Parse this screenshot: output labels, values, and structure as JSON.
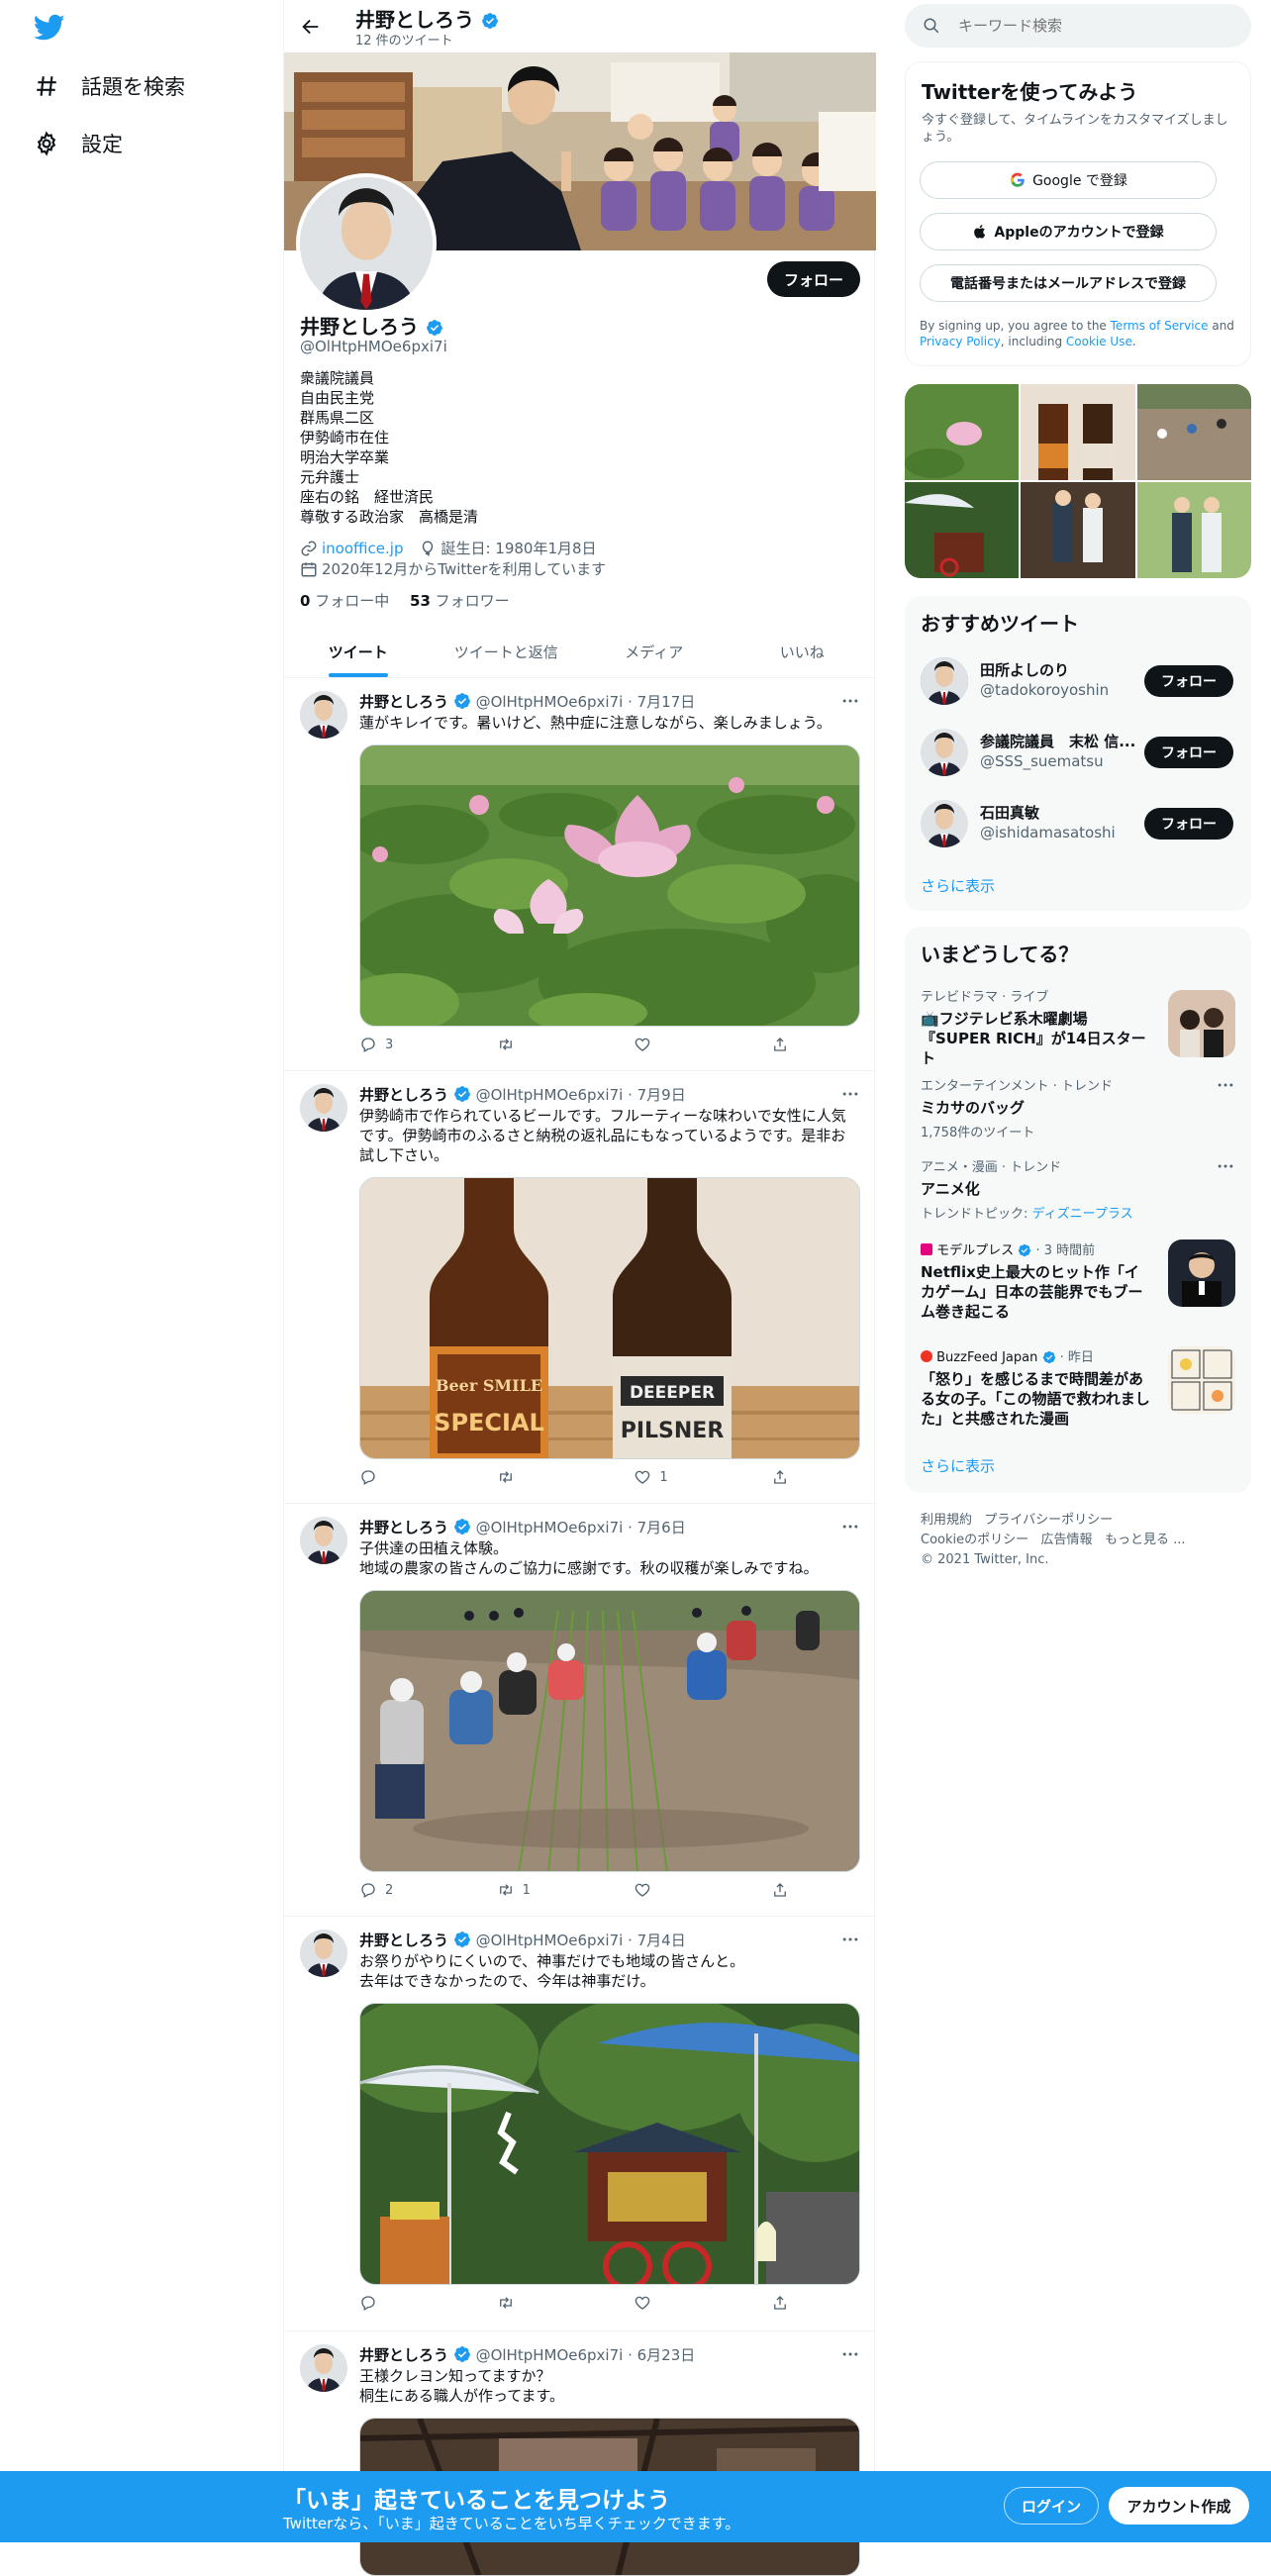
{
  "colors": {
    "accent": "#1d9bf0",
    "text": "#0f1419",
    "muted": "#536471",
    "banner": "#1d9bf0"
  },
  "nav": {
    "explore_label": "話題を検索",
    "settings_label": "設定"
  },
  "header": {
    "name": "井野としろう",
    "tweet_count": "12 件のツイート"
  },
  "profile": {
    "name": "井野としろう",
    "handle": "@OlHtpHMOe6pxi7i",
    "follow_label": "フォロー",
    "bio": [
      "衆議院議員",
      "自由民主党",
      "群馬県二区",
      "伊勢崎市在住",
      "明治大学卒業",
      "元弁護士",
      "座右の銘　経世済民",
      "尊敬する政治家　高橋是清"
    ],
    "website": "inooffice.jp",
    "birthday": "誕生日: 1980年1月8日",
    "joined": "2020年12月からTwitterを利用しています",
    "following_count": "0",
    "following_label": "フォロー中",
    "followers_count": "53",
    "followers_label": "フォロワー"
  },
  "tabs": [
    "ツイート",
    "ツイートと返信",
    "メディア",
    "いいね"
  ],
  "tweets": [
    {
      "name": "井野としろう",
      "handle": "@OlHtpHMOe6pxi7i",
      "date": "· 7月17日",
      "text": "蓮がキレイです。暑いけど、熱中症に注意しながら、楽しみましょう。",
      "reply": "3",
      "retweet": "",
      "like": ""
    },
    {
      "name": "井野としろう",
      "handle": "@OlHtpHMOe6pxi7i",
      "date": "· 7月9日",
      "text": "伊勢崎市で作られているビールです。フルーティーな味わいで女性に人気です。伊勢崎市のふるさと納税の返礼品にもなっているようです。是非お試し下さい。",
      "reply": "",
      "retweet": "",
      "like": "1",
      "beer1": "Beer SMILE",
      "beer1b": "SPECIAL",
      "beer2": "DEEEPER",
      "beer2b": "PILSNER"
    },
    {
      "name": "井野としろう",
      "handle": "@OlHtpHMOe6pxi7i",
      "date": "· 7月6日",
      "text": "子供達の田植え体験。\n地域の農家の皆さんのご協力に感謝です。秋の収穫が楽しみですね。",
      "reply": "2",
      "retweet": "1",
      "like": ""
    },
    {
      "name": "井野としろう",
      "handle": "@OlHtpHMOe6pxi7i",
      "date": "· 7月4日",
      "text": "お祭りがやりにくいので、神事だけでも地域の皆さんと。\n去年はできなかったので、今年は神事だけ。",
      "reply": "",
      "retweet": "",
      "like": ""
    },
    {
      "name": "井野としろう",
      "handle": "@OlHtpHMOe6pxi7i",
      "date": "· 6月23日",
      "text": "王様クレヨン知ってますか？\n桐生にある職人が作ってます。"
    }
  ],
  "search": {
    "placeholder": "キーワード検索"
  },
  "signup": {
    "title": "Twitterを使ってみよう",
    "subtitle": "今すぐ登録して、タイムラインをカスタマイズしましょう。",
    "google_label": "Google で登録",
    "apple_label": "Appleのアカウントで登録",
    "phone_label": "電話番号またはメールアドレスで登録",
    "legal_prefix": "By signing up, you agree to the ",
    "terms": "Terms of Service",
    "and": " and ",
    "privacy": "Privacy Policy",
    "including": ", including ",
    "cookie": "Cookie Use",
    "period": "."
  },
  "who": {
    "title": "おすすめツイート",
    "users": [
      {
        "name": "田所よしのり",
        "handle": "@tadokoroyoshin",
        "follow": "フォロー"
      },
      {
        "name": "参議院議員　末松 信...",
        "handle": "@SSS_suematsu",
        "follow": "フォロー"
      },
      {
        "name": "石田真敏",
        "handle": "@ishidamasatoshi",
        "follow": "フォロー"
      }
    ],
    "more": "さらに表示"
  },
  "trends": {
    "title": "いまどうしてる？",
    "items": [
      {
        "meta": "テレビドラマ · ライブ",
        "title": "📺フジテレビ系木曜劇場『SUPER RICH』が14日スタート"
      },
      {
        "meta": "エンターテインメント · トレンド",
        "title": "ミカサのバッグ",
        "sub": "1,758件のツイート"
      },
      {
        "meta": "アニメ・漫画 · トレンド",
        "title": "アニメ化",
        "sub_prefix": "トレンドトピック: ",
        "sub_link": "ディズニープラス"
      },
      {
        "source": "モデルプレス",
        "time": "· 3 時間前",
        "title": "Netflix史上最大のヒット作「イカゲーム」日本の芸能界でもブーム巻き起こる"
      },
      {
        "source": "BuzzFeed Japan",
        "time": "· 昨日",
        "title": "「怒り」を感じるまで時間差がある女の子。「この物語で救われました」と共感された漫画"
      }
    ],
    "more": "さらに表示"
  },
  "footer": {
    "links": [
      "利用規約",
      "プライバシーポリシー",
      "Cookieのポリシー",
      "広告情報",
      "もっと見る ..."
    ],
    "copyright": "© 2021 Twitter, Inc."
  },
  "banner": {
    "title": "「いま」起きていることを見つけよう",
    "subtitle": "Twitterなら、「いま」起きていることをいち早くチェックできます。",
    "login": "ログイン",
    "signup": "アカウント作成"
  }
}
